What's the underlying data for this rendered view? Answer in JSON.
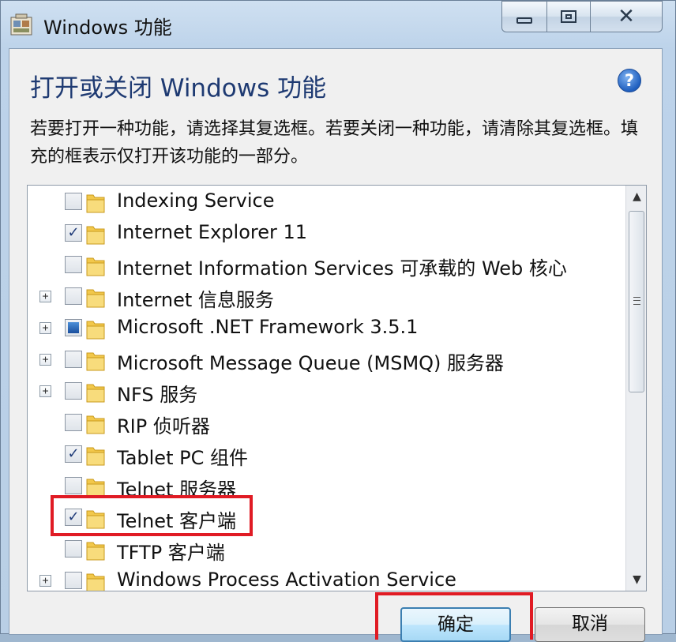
{
  "window": {
    "title": "Windows 功能",
    "heading": "打开或关闭 Windows 功能",
    "description": "若要打开一种功能，请选择其复选框。若要关闭一种功能，请清除其复选框。填充的框表示仅打开该功能的一部分。",
    "help_glyph": "?"
  },
  "features": [
    {
      "label": "Indexing Service",
      "state": "unchecked",
      "expandable": false
    },
    {
      "label": "Internet Explorer 11",
      "state": "checked",
      "expandable": false
    },
    {
      "label": "Internet Information Services 可承载的 Web 核心",
      "state": "unchecked",
      "expandable": false
    },
    {
      "label": "Internet 信息服务",
      "state": "unchecked",
      "expandable": true
    },
    {
      "label": "Microsoft .NET Framework 3.5.1",
      "state": "partial",
      "expandable": true
    },
    {
      "label": "Microsoft Message Queue (MSMQ) 服务器",
      "state": "unchecked",
      "expandable": true
    },
    {
      "label": "NFS 服务",
      "state": "unchecked",
      "expandable": true
    },
    {
      "label": "RIP 侦听器",
      "state": "unchecked",
      "expandable": false
    },
    {
      "label": "Tablet PC 组件",
      "state": "checked",
      "expandable": false
    },
    {
      "label": "Telnet 服务器",
      "state": "unchecked",
      "expandable": false
    },
    {
      "label": "Telnet 客户端",
      "state": "checked",
      "expandable": false
    },
    {
      "label": "TFTP 客户端",
      "state": "unchecked",
      "expandable": false
    },
    {
      "label": "Windows Process Activation Service",
      "state": "unchecked",
      "expandable": true
    }
  ],
  "buttons": {
    "ok": "确定",
    "cancel": "取消"
  },
  "icons": {
    "app": "windows-features-icon",
    "folder": "folder-icon",
    "help": "help-icon"
  },
  "colors": {
    "heading": "#1e3a72",
    "highlight": "#e01b24",
    "folder": "#f2c84b"
  }
}
